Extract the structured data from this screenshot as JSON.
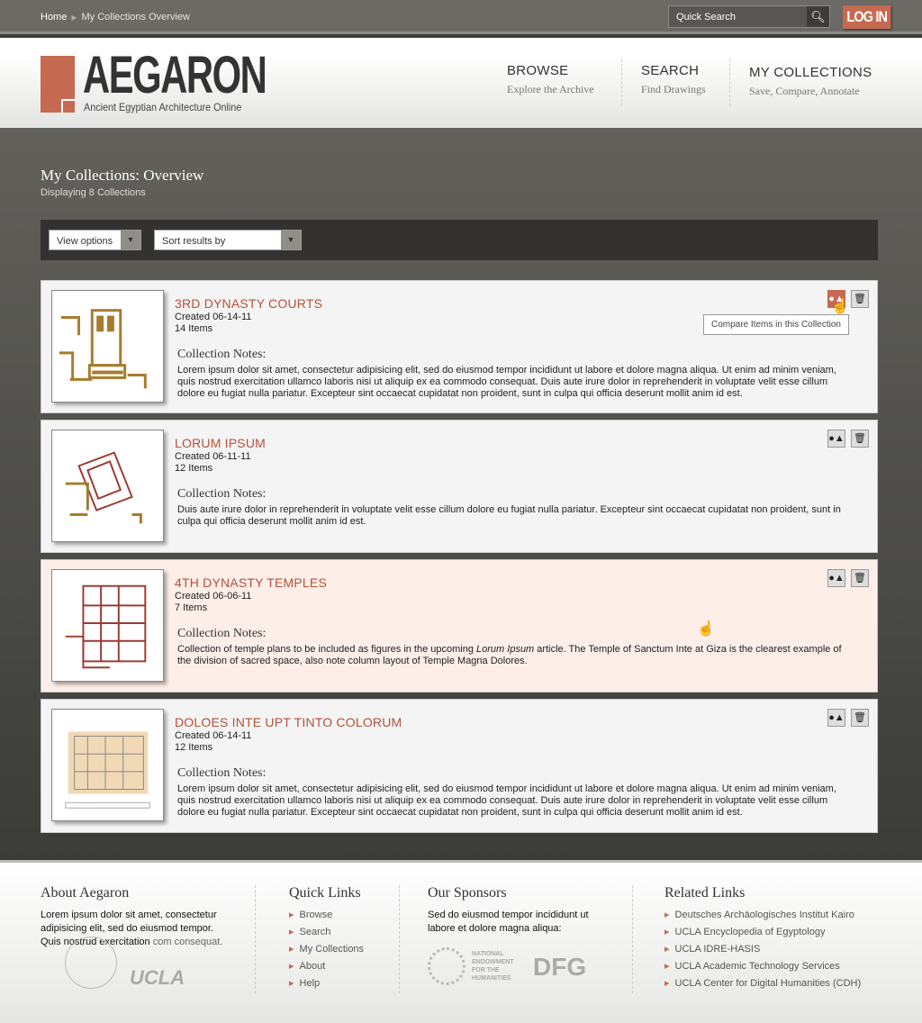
{
  "topbar": {
    "breadcrumb_home": "Home",
    "breadcrumb_current": "My Collections Overview",
    "search_placeholder": "Quick Search",
    "login": "LOG IN"
  },
  "header": {
    "logo": "AEGARON",
    "logo_sub": "Ancient Egyptian Architecture Online",
    "nav": [
      {
        "title": "BROWSE",
        "sub": "Explore the Archive"
      },
      {
        "title": "SEARCH",
        "sub": "Find Drawings"
      },
      {
        "title": "MY COLLECTIONS",
        "sub": "Save, Compare, Annotate"
      }
    ]
  },
  "page": {
    "title": "My Collections: Overview",
    "subtitle": "Displaying 8 Collections",
    "view_options": "View options",
    "sort": "Sort results by"
  },
  "notes_label": "Collection Notes:",
  "tooltip": "Compare Items in this Collection",
  "collections": [
    {
      "title": "3RD DYNASTY COURTS",
      "created": "Created 06-14-11",
      "items": "14 Items",
      "notes": "Lorem ipsum dolor sit amet, consectetur adipisicing elit, sed do eiusmod tempor incididunt ut labore et dolore magna aliqua. Ut enim ad minim veniam, quis nostrud exercitation ullamco laboris nisi ut aliquip ex ea commodo consequat. Duis aute irure dolor in reprehenderit in voluptate velit esse cillum dolore eu fugiat nulla pariatur. Excepteur sint occaecat cupidatat non proident, sunt in culpa qui officia deserunt mollit anim id est."
    },
    {
      "title": "LORUM IPSUM",
      "created": "Created 06-11-11",
      "items": "12 Items",
      "notes": "Duis aute irure dolor in reprehenderit in voluptate velit esse cillum dolore eu fugiat nulla pariatur. Excepteur sint occaecat cupidatat non proident, sunt in culpa qui officia deserunt mollit anim id est."
    },
    {
      "title": "4TH DYNASTY TEMPLES",
      "created": "Created 06-06-11",
      "items": "7 Items",
      "notes_a": "Collection of temple plans to be included as figures in the upcoming ",
      "notes_em": "Lorum Ipsum",
      "notes_b": " article. The Temple of Sanctum Inte at Giza is the clearest example of the division of sacred space, also note column layout of Temple Magna Dolores."
    },
    {
      "title": "DOLOES INTE UPT TINTO COLORUM",
      "created": "Created 06-14-11",
      "items": "12 Items",
      "notes": "Lorem ipsum dolor sit amet, consectetur adipisicing elit, sed do eiusmod tempor incididunt ut labore et dolore magna aliqua. Ut enim ad minim veniam, quis nostrud exercitation ullamco laboris nisi ut aliquip ex ea commodo consequat. Duis aute irure dolor in reprehenderit in voluptate velit esse cillum dolore eu fugiat nulla pariatur. Excepteur sint occaecat cupidatat non proident, sunt in culpa qui officia deserunt mollit anim id est."
    }
  ],
  "footer": {
    "about": {
      "title": "About Aegaron",
      "text": "Lorem ipsum dolor sit amet, consectetur adipisicing elit, sed do eiusmod tempor. Quis nostrud exercitation ",
      "text_link": "com consequat.",
      "logo_ucla": "UCLA"
    },
    "quick": {
      "title": "Quick Links",
      "items": [
        "Browse",
        "Search",
        "My Collections",
        "About",
        "Help"
      ]
    },
    "sponsors": {
      "title": "Our Sponsors",
      "text": "Sed do eiusmod tempor incididunt ut labore et dolore magna aliqua:",
      "neh": "NATIONAL ENDOWMENT FOR THE HUMANITIES",
      "dfg": "DFG"
    },
    "related": {
      "title": "Related Links",
      "items": [
        "Deutsches Archäologisches Institut Kairo",
        "UCLA Encyclopedia of Egyptology",
        "UCLA IDRE-HASIS",
        "UCLA Academic Technology Services",
        "UCLA Center for Digital Humanities (CDH)"
      ]
    }
  },
  "colors": {
    "accent": "#c56a51",
    "title": "#b5503a"
  }
}
